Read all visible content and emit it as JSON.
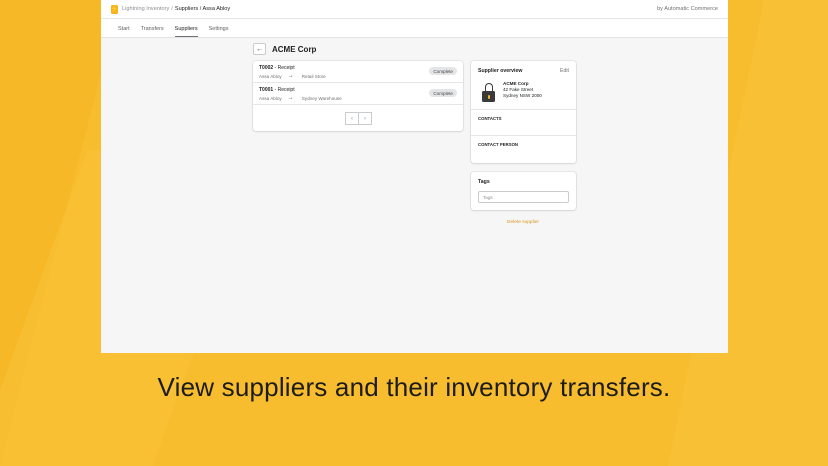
{
  "app": {
    "name": "Lightning Inventory",
    "breadcrumb_current": "Suppliers / Assa Abloy",
    "vendor": "by Automatic Commerce",
    "logo_glyph": "⚡"
  },
  "tabs": [
    "Start",
    "Transfers",
    "Suppliers",
    "Settings"
  ],
  "page": {
    "title": "ACME Corp",
    "back_glyph": "←"
  },
  "transfers": [
    {
      "number": "T0002",
      "type": "Receipt",
      "from": "Assa Abloy",
      "to": "Retail Store",
      "status": "Complete"
    },
    {
      "number": "T0001",
      "type": "Receipt",
      "from": "Assa Abloy",
      "to": "Sydney Warehouse",
      "status": "Complete"
    }
  ],
  "pagination": {
    "prev": "‹",
    "next": "›"
  },
  "overview": {
    "title": "Supplier overview",
    "edit": "Edit",
    "name": "ACME Corp",
    "street": "42 Fake Street",
    "city": "Sydney NSW 2000",
    "contacts_label": "CONTACTS",
    "contact_person_label": "CONTACT PERSON",
    "icon": "lock-icon"
  },
  "tags": {
    "title": "Tags",
    "placeholder": "Tags"
  },
  "delete_label": "Delete supplier",
  "caption": "View suppliers and their inventory transfers.",
  "colors": {
    "background": "#f8bd2e",
    "accent": "#f7b21c",
    "link": "#d8971e"
  }
}
